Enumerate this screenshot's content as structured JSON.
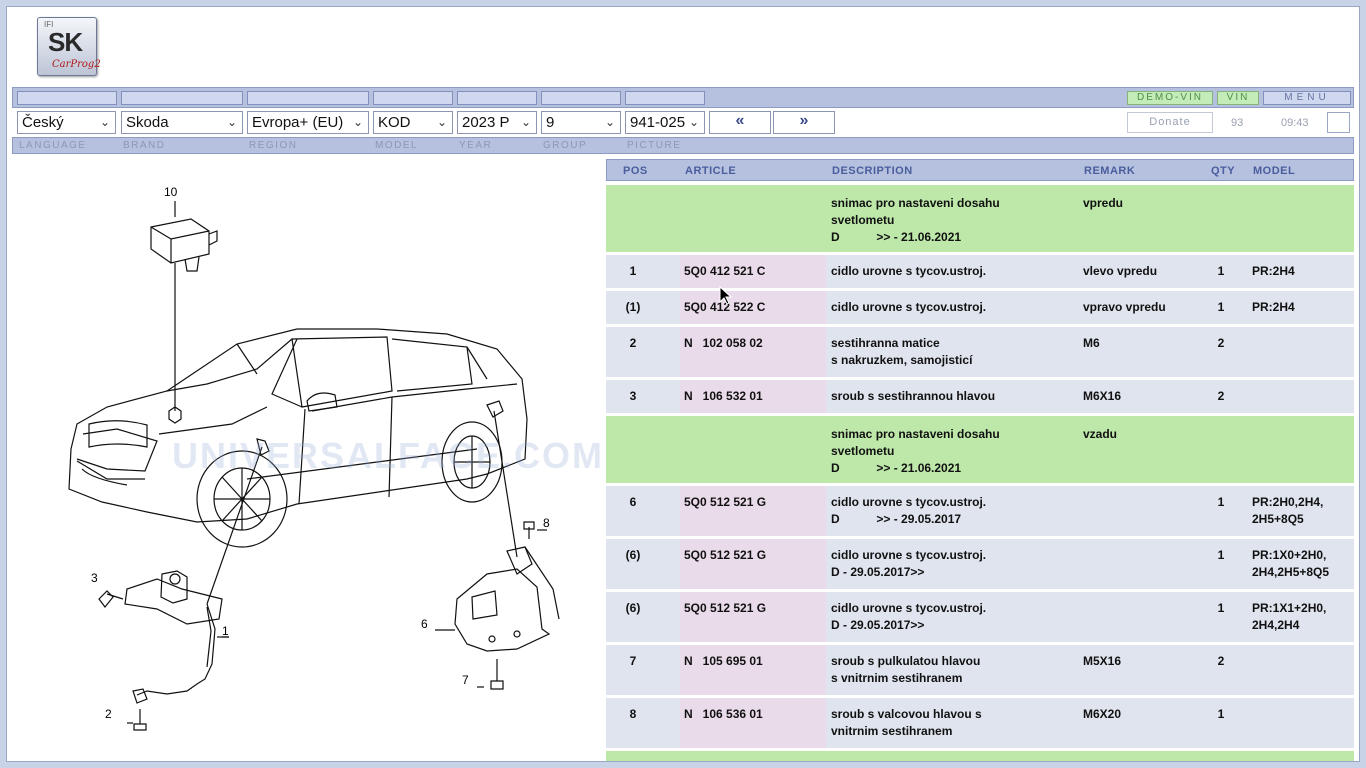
{
  "logo": {
    "small": "IFI",
    "big": "SK",
    "script": "CarProg2"
  },
  "top_buttons": {
    "demo_vin": "DEMO-VIN",
    "vin": "VIN",
    "menu": "MENU"
  },
  "selects": {
    "language": "Český",
    "brand": "Skoda",
    "region": "Evropa+ (EU)",
    "model": "KOD",
    "year": "2023  P",
    "group": "9",
    "picture": "941-025"
  },
  "nav": {
    "prev": "«",
    "next": "»"
  },
  "status": {
    "donate": "Donate",
    "count": "93",
    "time": "09:43"
  },
  "labels": {
    "language": "LANGUAGE",
    "brand": "BRAND",
    "region": "REGION",
    "model": "MODEL",
    "year": "YEAR",
    "group": "GROUP",
    "picture": "PICTURE"
  },
  "watermark": "UNIVERSALFACE.COM",
  "diagram_callouts": {
    "c10": "10",
    "c8": "8",
    "c3": "3",
    "c1": "1",
    "c6": "6",
    "c2": "2",
    "c7": "7"
  },
  "table": {
    "headers": {
      "pos": "POS",
      "article": "ARTICLE",
      "description": "DESCRIPTION",
      "remark": "REMARK",
      "qty": "QTY",
      "model": "MODEL"
    },
    "rows": [
      {
        "pos": "",
        "article": "",
        "description": "snimac pro nastaveni dosahu\nsvetlometu\nD           >> - 21.06.2021",
        "remark": "vpredu",
        "qty": "",
        "model": ""
      },
      {
        "pos": "1",
        "article": "5Q0 412 521 C",
        "description": "cidlo urovne s tycov.ustroj.",
        "remark": "vlevo vpredu",
        "qty": "1",
        "model": "PR:2H4"
      },
      {
        "pos": "(1)",
        "article": "5Q0 412 522 C",
        "description": "cidlo urovne s tycov.ustroj.",
        "remark": "vpravo vpredu",
        "qty": "1",
        "model": "PR:2H4"
      },
      {
        "pos": "2",
        "article": "N   102 058 02",
        "description": "sestihranna matice\ns nakruzkem, samojisticí",
        "remark": "M6",
        "qty": "2",
        "model": ""
      },
      {
        "pos": "3",
        "article": "N   106 532 01",
        "description": "sroub s sestihrannou hlavou",
        "remark": "M6X16",
        "qty": "2",
        "model": ""
      },
      {
        "pos": "",
        "article": "",
        "description": "snimac pro nastaveni dosahu\nsvetlometu\nD           >> - 21.06.2021",
        "remark": "vzadu",
        "qty": "",
        "model": ""
      },
      {
        "pos": "6",
        "article": "5Q0 512 521 G",
        "description": "cidlo urovne s tycov.ustroj.\nD           >> - 29.05.2017",
        "remark": "",
        "qty": "1",
        "model": "PR:2H0,2H4,\n2H5+8Q5"
      },
      {
        "pos": "(6)",
        "article": "5Q0 512 521 G",
        "description": "cidlo urovne s tycov.ustroj.\nD - 29.05.2017>>",
        "remark": "",
        "qty": "1",
        "model": "PR:1X0+2H0,\n2H4,2H5+8Q5"
      },
      {
        "pos": "(6)",
        "article": "5Q0 512 521 G",
        "description": "cidlo urovne s tycov.ustroj.\nD - 29.05.2017>>",
        "remark": "",
        "qty": "1",
        "model": "PR:1X1+2H0,\n2H4,2H4"
      },
      {
        "pos": "7",
        "article": "N   105 695 01",
        "description": "sroub s pulkulatou hlavou\ns vnitrnim sestihranem",
        "remark": "M5X16",
        "qty": "2",
        "model": ""
      },
      {
        "pos": "8",
        "article": "N   106 536 01",
        "description": "sroub s valcovou hlavou s\nvnitrnim sestihranem",
        "remark": "M6X20",
        "qty": "1",
        "model": ""
      },
      {
        "pos": "",
        "article": "",
        "description": "",
        "remark": "",
        "qty": "",
        "model": ""
      }
    ]
  }
}
